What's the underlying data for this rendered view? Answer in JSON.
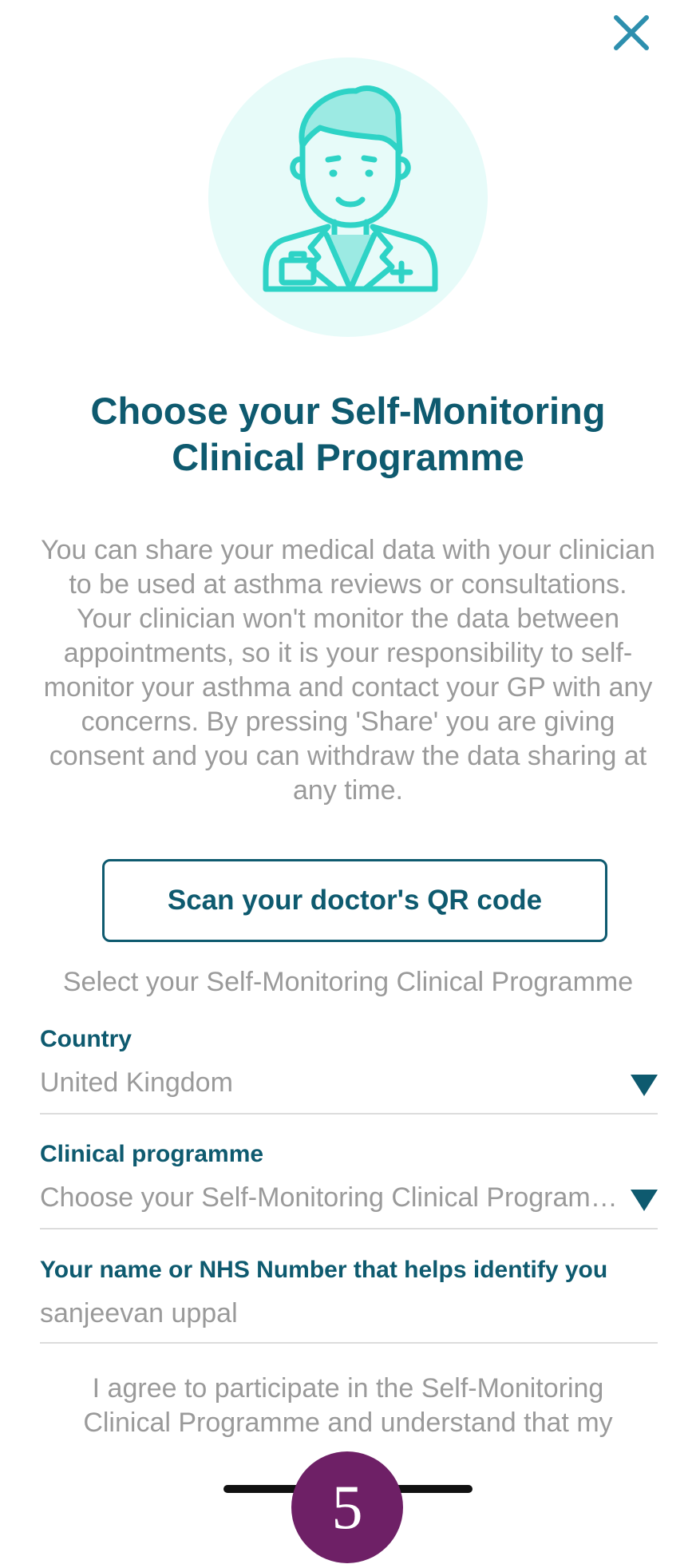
{
  "header": {
    "close_icon": "close-icon"
  },
  "hero": {
    "icon": "doctor-avatar-icon",
    "title_line1": "Choose your Self-Monitoring",
    "title_line2": "Clinical Programme"
  },
  "description": "You can share your medical data with your clinician to be used at asthma reviews or consultations. Your clinician won't monitor the data between appointments, so it is your responsibility to self-monitor your asthma and contact your GP with any concerns. By pressing 'Share' you are giving consent and you can withdraw the data sharing at any time.",
  "scan_button_label": "Scan your doctor's QR code",
  "select_prompt": "Select your Self-Monitoring Clinical Programme",
  "fields": {
    "country": {
      "label": "Country",
      "value": "United Kingdom"
    },
    "programme": {
      "label": "Clinical programme",
      "placeholder": "Choose your Self-Monitoring Clinical Programme"
    },
    "identifier": {
      "label": "Your name or NHS Number that helps identify you",
      "value": "sanjeevan uppal"
    }
  },
  "agreement_text": "I agree to participate in the Self-Monitoring Clinical Programme and understand that my clinician won't monitor my asthma outside of appointments.",
  "badge": "5",
  "colors": {
    "primary": "#0e5a6f",
    "accent": "#2ed3c6",
    "avatar_bg": "#e7fbf9",
    "muted_text": "#9a9a9a",
    "badge": "#6e2066"
  }
}
